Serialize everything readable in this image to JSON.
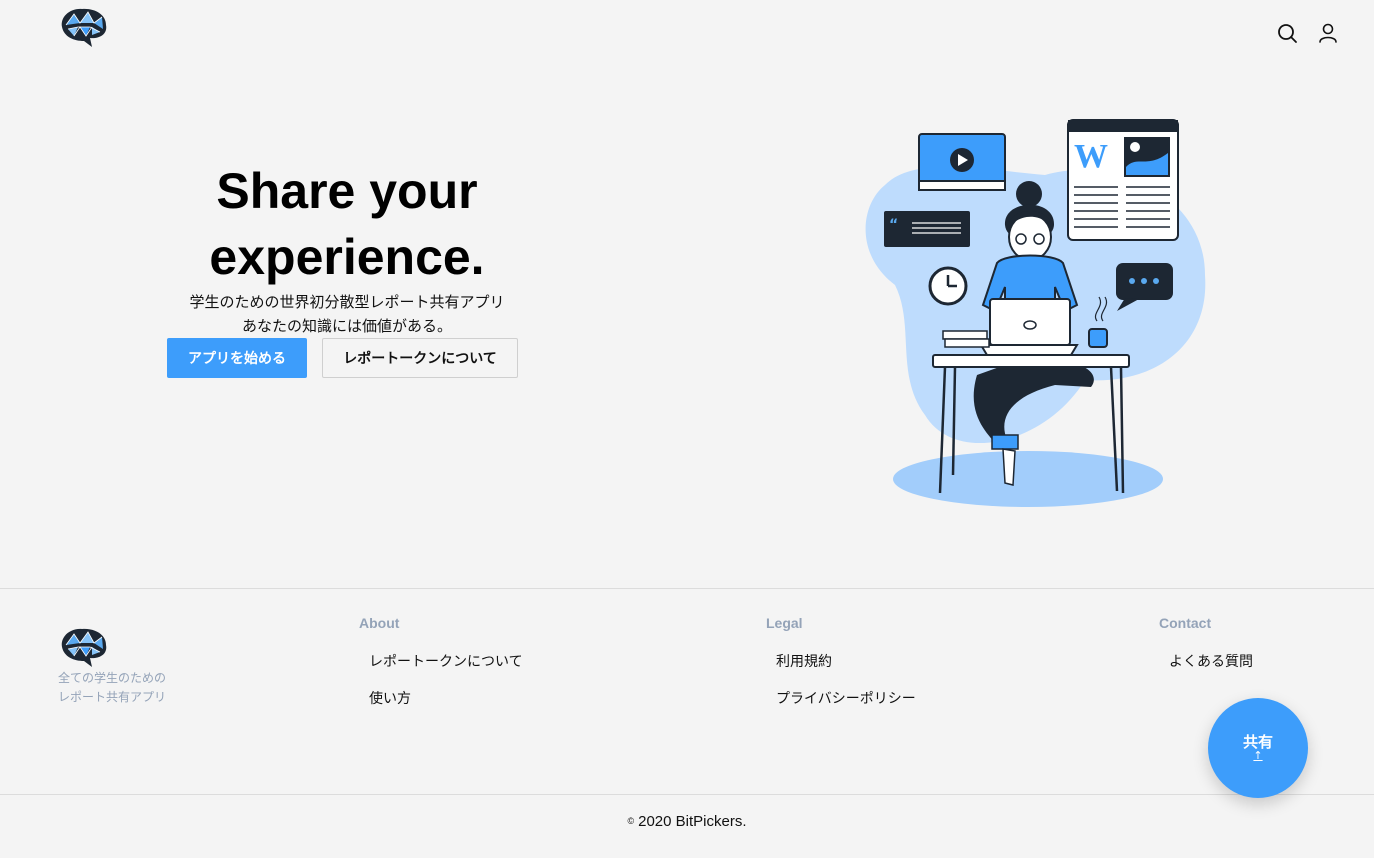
{
  "header": {
    "logo_name": "brain-logo",
    "icons": [
      "search-icon",
      "user-icon"
    ]
  },
  "hero": {
    "title_line1": "Share your",
    "title_line2": "experience.",
    "subtitle_line1": "学生のための世界初分散型レポート共有アプリ",
    "subtitle_line2": "あなたの知識には価値がある。",
    "primary_button": "アプリを始める",
    "secondary_button": "レポートークンについて"
  },
  "footer": {
    "tagline_line1": "全ての学生のための",
    "tagline_line2": "レポート共有アプリ",
    "about": {
      "heading": "About",
      "links": [
        "レポートークンについて",
        "使い方"
      ]
    },
    "legal": {
      "heading": "Legal",
      "links": [
        "利用規約",
        "プライバシーポリシー"
      ]
    },
    "contact": {
      "heading": "Contact",
      "links": [
        "よくある質問"
      ]
    },
    "copyright_symbol": "©",
    "copyright": "2020 BitPickers."
  },
  "fab": {
    "label": "共有",
    "arrow": "↑"
  },
  "colors": {
    "accent": "#3d9dfb",
    "muted": "#94a3b8",
    "background": "#f4f4f4"
  }
}
